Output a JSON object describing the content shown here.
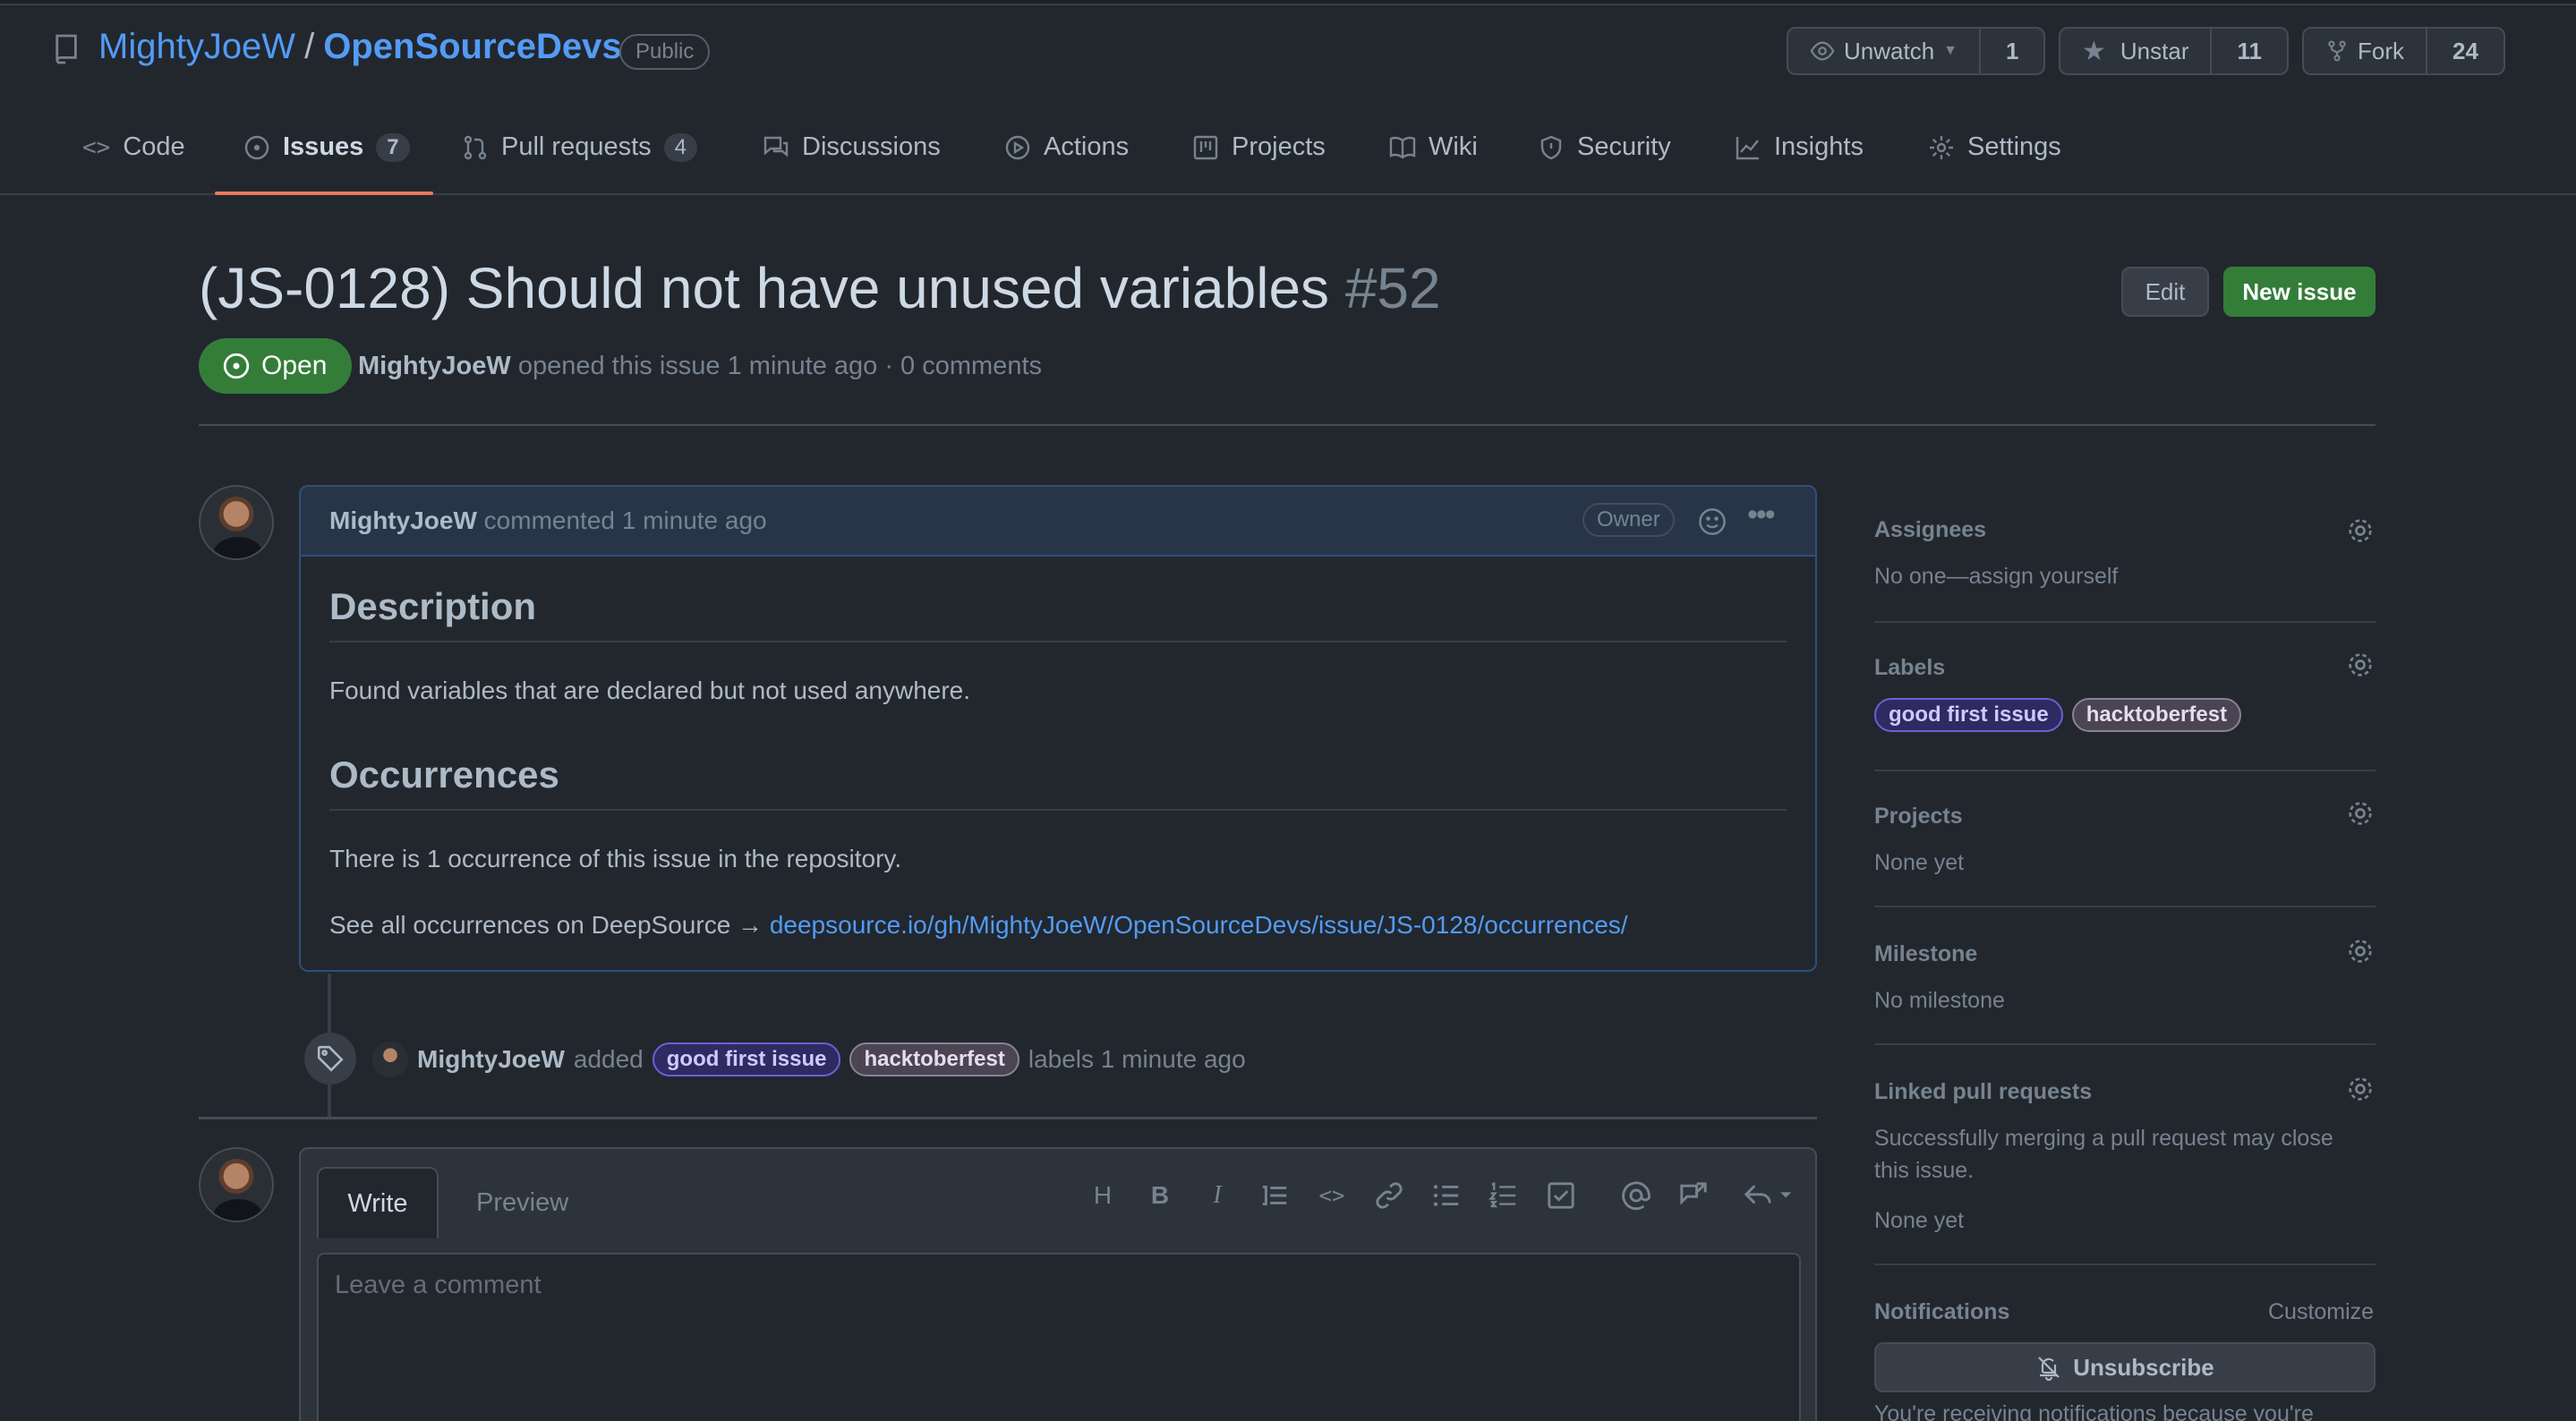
{
  "repo": {
    "owner": "MightyJoeW",
    "separator": "/",
    "name": "OpenSourceDevs",
    "visibility": "Public"
  },
  "header_actions": {
    "unwatch_label": "Unwatch",
    "watch_count": "1",
    "unstar_label": "Unstar",
    "star_count": "11",
    "fork_label": "Fork",
    "fork_count": "24"
  },
  "tabs": [
    {
      "label": "Code"
    },
    {
      "label": "Issues",
      "count": "7"
    },
    {
      "label": "Pull requests",
      "count": "4"
    },
    {
      "label": "Discussions"
    },
    {
      "label": "Actions"
    },
    {
      "label": "Projects"
    },
    {
      "label": "Wiki"
    },
    {
      "label": "Security"
    },
    {
      "label": "Insights"
    },
    {
      "label": "Settings"
    }
  ],
  "issue": {
    "title": "(JS-0128) Should not have unused variables",
    "number": "#52",
    "state": "Open",
    "author": "MightyJoeW",
    "opened_text": "opened this issue 1 minute ago · 0 comments",
    "edit_label": "Edit",
    "new_issue_label": "New issue"
  },
  "comment": {
    "author": "MightyJoeW",
    "action_text": "commented 1 minute ago",
    "role_badge": "Owner",
    "heading1": "Description",
    "paragraph1": "Found variables that are declared but not used anywhere.",
    "heading2": "Occurrences",
    "paragraph2": "There is 1 occurrence of this issue in the repository.",
    "paragraph3_prefix": "See all occurrences on DeepSource →",
    "link_text": "deepsource.io/gh/MightyJoeW/OpenSourceDevs/issue/JS-0128/occurrences/"
  },
  "event": {
    "actor": "MightyJoeW",
    "verb": "added",
    "label1": "good first issue",
    "label2": "hacktoberfest",
    "suffix": "labels 1 minute ago"
  },
  "composer": {
    "write_tab": "Write",
    "preview_tab": "Preview",
    "placeholder": "Leave a comment",
    "heading_tool": "H",
    "bold_tool": "B",
    "italic_tool": "I"
  },
  "sidebar": {
    "assignees_title": "Assignees",
    "assignees_value": "No one—assign yourself",
    "labels_title": "Labels",
    "label1": "good first issue",
    "label2": "hacktoberfest",
    "projects_title": "Projects",
    "projects_value": "None yet",
    "milestone_title": "Milestone",
    "milestone_value": "No milestone",
    "linked_title": "Linked pull requests",
    "linked_desc_line1": "Successfully merging a pull request may close",
    "linked_desc_line2": "this issue.",
    "linked_value": "None yet",
    "notifications_title": "Notifications",
    "customize_label": "Customize",
    "unsubscribe_label": "Unsubscribe",
    "notifications_desc": "You're receiving notifications because you're"
  },
  "colors": {
    "accent_link": "#539bf5",
    "open_green": "#347d39",
    "active_tab_underline": "#ec775c"
  }
}
